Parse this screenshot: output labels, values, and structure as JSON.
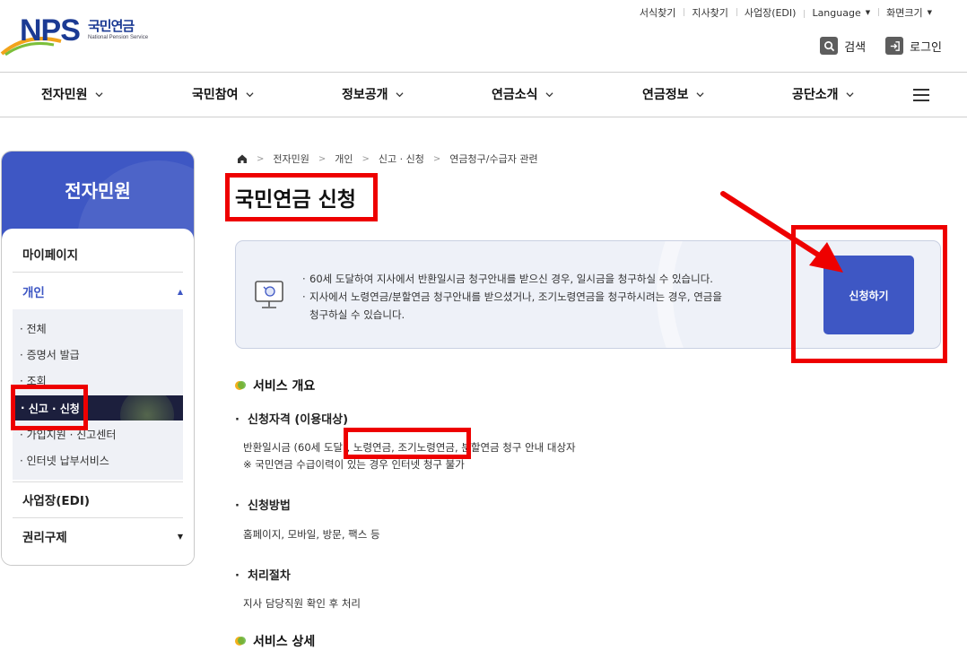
{
  "brand": {
    "logo_text": "NPS",
    "name_kr": "국민연금",
    "name_en": "National Pension Service"
  },
  "utility": {
    "items": [
      "서식찾기",
      "지사찾기",
      "사업장(EDI)",
      "Language",
      "화면크기"
    ]
  },
  "actions": {
    "search": "검색",
    "login": "로그인"
  },
  "gnb": {
    "items": [
      "전자민원",
      "국민참여",
      "정보공개",
      "연금소식",
      "연금정보",
      "공단소개"
    ]
  },
  "side": {
    "title": "전자민원",
    "mypage": "마이페이지",
    "personal": "개인",
    "sub": [
      "전체",
      "증명서 발급",
      "조회",
      "신고 · 신청",
      "가입지원 · 신고센터",
      "인터넷 납부서비스"
    ],
    "business": "사업장(EDI)",
    "rights": "권리구제"
  },
  "breadcrumb": [
    "전자민원",
    "개인",
    "신고 · 신청",
    "연금청구/수급자 관련"
  ],
  "page": {
    "title": "국민연금 신청"
  },
  "info": {
    "line1": "60세 도달하여 지사에서 반환일시금 청구안내를 받으신 경우, 일시금을 청구하실 수 있습니다.",
    "line2": "지사에서 노령연금/분할연금 청구안내를 받으셨거나, 조기노령연금을 청구하시려는 경우, 연금을",
    "line3": "청구하실 수 있습니다.",
    "apply_button": "신청하기"
  },
  "overview": {
    "title": "서비스 개요",
    "eligibility_title": "신청자격 (이용대상)",
    "eligibility_text": "반환일시금 (60세 도달), 노령연금, 조기노령연금, 분할연금 청구 안내 대상자",
    "eligibility_note": "※ 국민연금 수급이력이 있는 경우 인터넷 청구 불가",
    "method_title": "신청방법",
    "method_text": "홈페이지, 모바일, 방문, 팩스 등",
    "process_title": "처리절차",
    "process_text": "지사 담당직원 확인 후 처리"
  },
  "detail": {
    "title": "서비스 상세"
  },
  "colors": {
    "brand_blue": "#3e57c4",
    "active_menu": "#1c1f3d",
    "highlight_red": "#ee0000"
  }
}
